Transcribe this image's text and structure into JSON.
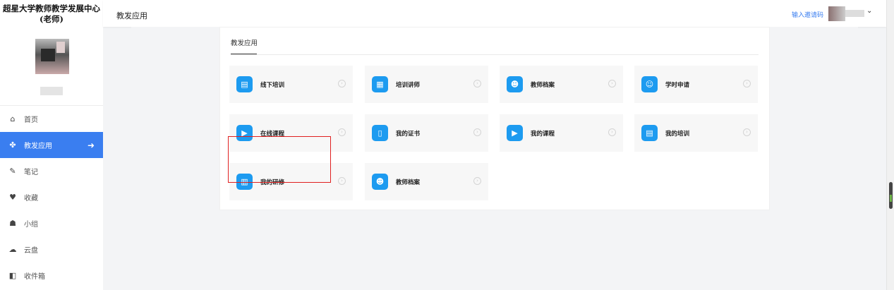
{
  "sidebar": {
    "org_title_line1": "超星大学教师教学发展中心",
    "org_title_line2": "(老师)",
    "items": [
      {
        "label": "首页",
        "icon": "home-icon",
        "glyph": "⌂",
        "active": false
      },
      {
        "label": "教发应用",
        "icon": "apps-icon",
        "glyph": "✤",
        "active": true
      },
      {
        "label": "笔记",
        "icon": "note-icon",
        "glyph": "✎",
        "active": false
      },
      {
        "label": "收藏",
        "icon": "heart-icon",
        "glyph": "♥",
        "active": false
      },
      {
        "label": "小组",
        "icon": "group-icon",
        "glyph": "☗",
        "active": false
      },
      {
        "label": "云盘",
        "icon": "cloud-icon",
        "glyph": "☁",
        "active": false
      },
      {
        "label": "收件箱",
        "icon": "inbox-icon",
        "glyph": "◧",
        "active": false
      }
    ],
    "active_arrow": "➜"
  },
  "header": {
    "title": "教发应用",
    "invite_link": "输入邀请码",
    "chevron": "⌄"
  },
  "card": {
    "title": "教发应用",
    "tiles": [
      {
        "label": "线下培训",
        "icon": "presentation-icon",
        "glyph": "▤"
      },
      {
        "label": "培训讲师",
        "icon": "lecturer-icon",
        "glyph": "▦"
      },
      {
        "label": "教师档案",
        "icon": "teacher-profile-icon",
        "glyph": "☻"
      },
      {
        "label": "学时申请",
        "icon": "person-icon",
        "glyph": "☺"
      },
      {
        "label": "在线课程",
        "icon": "online-course-icon",
        "glyph": "▶"
      },
      {
        "label": "我的证书",
        "icon": "certificate-icon",
        "glyph": "▯"
      },
      {
        "label": "我的课程",
        "icon": "video-icon",
        "glyph": "▶"
      },
      {
        "label": "我的培训",
        "icon": "training-icon",
        "glyph": "▤"
      },
      {
        "label": "我的研修",
        "icon": "study-icon",
        "glyph": "▥"
      },
      {
        "label": "教师档案",
        "icon": "teacher-profile-icon",
        "glyph": "☻"
      }
    ],
    "go_glyph": "›"
  },
  "colors": {
    "accent": "#3a7ef0",
    "tile_icon": "#1d9bf0",
    "highlight": "#e02020"
  }
}
